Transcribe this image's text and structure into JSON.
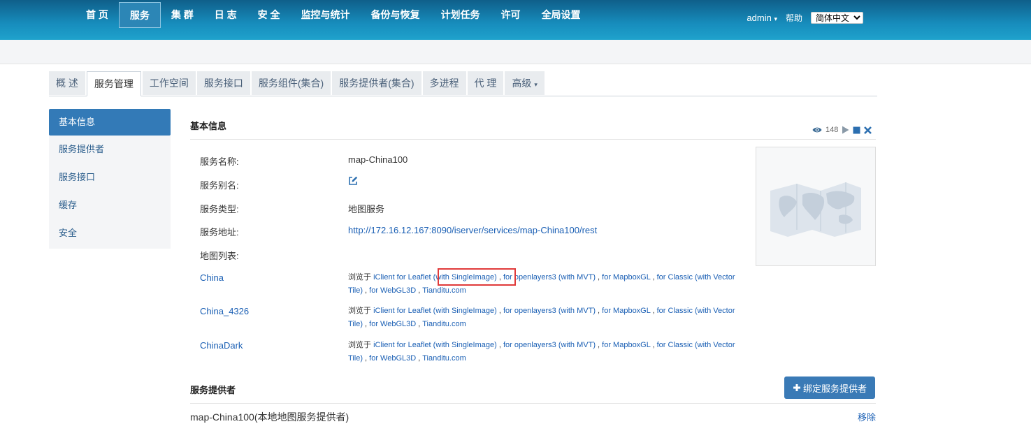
{
  "nav": {
    "items": [
      "首 页",
      "服务",
      "集 群",
      "日 志",
      "安 全",
      "监控与统计",
      "备份与恢复",
      "计划任务",
      "许可",
      "全局设置"
    ],
    "active": 1,
    "user": "admin",
    "user_caret": "▾",
    "help": "帮助",
    "language": "简体中文"
  },
  "tabs": {
    "items": [
      "概 述",
      "服务管理",
      "工作空间",
      "服务接口",
      "服务组件(集合)",
      "服务提供者(集合)",
      "多进程",
      "代 理",
      "高级"
    ],
    "active": 1,
    "caret": "▾"
  },
  "sidebar": {
    "items": [
      "基本信息",
      "服务提供者",
      "服务接口",
      "缓存",
      "安全"
    ],
    "active": 0
  },
  "basic": {
    "title": "基本信息",
    "view_count": "148",
    "labels": {
      "name": "服务名称:",
      "alias": "服务别名:",
      "type": "服务类型:",
      "address": "服务地址:",
      "map_list": "地图列表:"
    },
    "values": {
      "name": "map-China100",
      "type": "地图服务",
      "address": "http://172.16.12.167:8090/iserver/services/map-China100/rest"
    }
  },
  "maps": [
    {
      "name": "China",
      "prefix": "浏览于",
      "links": [
        "iClient for Leaflet (with SingleImage)",
        "for openlayers3 (with MVT)",
        "for MapboxGL",
        "for Classic (with Vector Tile)",
        "for WebGL3D",
        "Tianditu.com"
      ]
    },
    {
      "name": "China_4326",
      "prefix": "浏览于",
      "links": [
        "iClient for Leaflet (with SingleImage)",
        "for openlayers3 (with MVT)",
        "for MapboxGL",
        "for Classic (with Vector Tile)",
        "for WebGL3D",
        "Tianditu.com"
      ]
    },
    {
      "name": "ChinaDark",
      "prefix": "浏览于",
      "links": [
        "iClient for Leaflet (with SingleImage)",
        "for openlayers3 (with MVT)",
        "for MapboxGL",
        "for Classic (with Vector Tile)",
        "for WebGL3D",
        "Tianditu.com"
      ]
    }
  ],
  "providers": {
    "title": "服务提供者",
    "bind_button": "绑定服务提供者",
    "row_name": "map-China100(本地地图服务提供者)",
    "remove": "移除"
  },
  "colors": {
    "accent": "#337ab7",
    "link": "#1a5fb4",
    "highlight": "#e03a3a"
  }
}
